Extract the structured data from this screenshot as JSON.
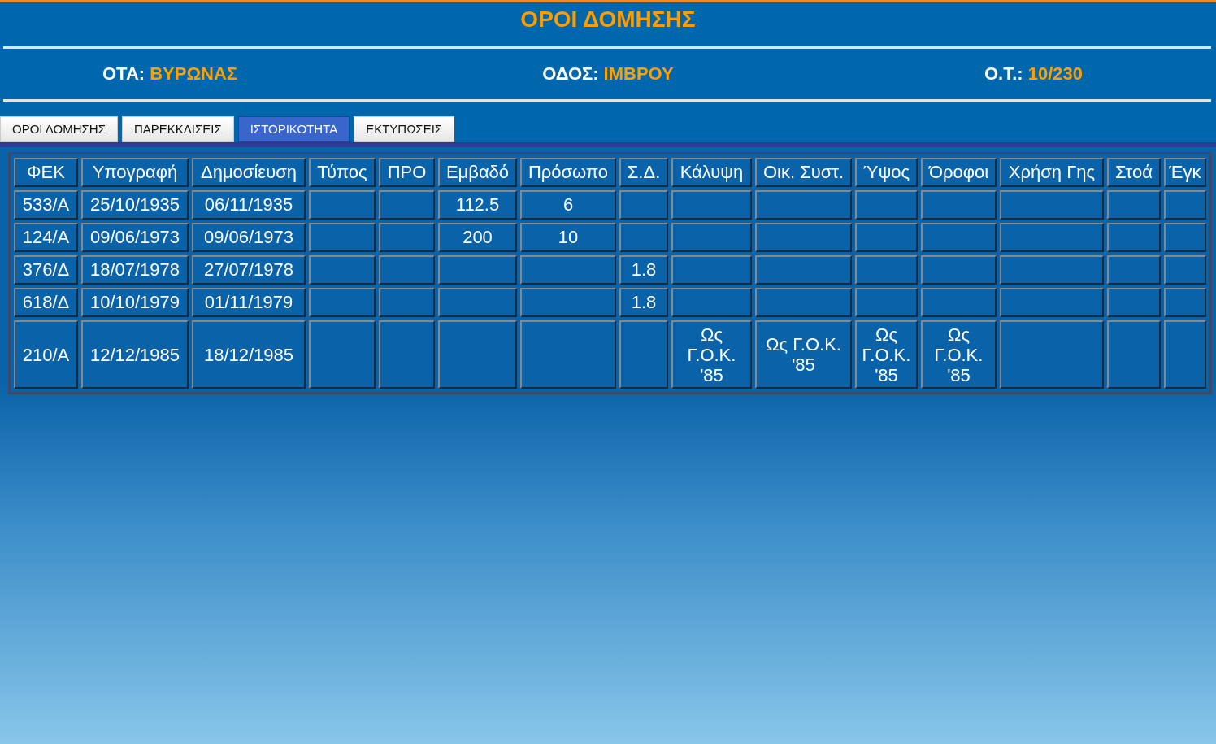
{
  "title": "ΟΡΟΙ ΔΟΜΗΣΗΣ",
  "info": [
    {
      "label": "ΟΤΑ:",
      "value": "ΒΥΡΩΝΑΣ"
    },
    {
      "label": "ΟΔΟΣ:",
      "value": "ΙΜΒΡΟΥ"
    },
    {
      "label": "Ο.Τ.:",
      "value": "10/230"
    }
  ],
  "tabs": [
    {
      "label": "ΟΡΟΙ ΔΟΜΗΣΗΣ",
      "selected": false
    },
    {
      "label": "ΠΑΡΕΚΚΛΙΣΕΙΣ",
      "selected": false
    },
    {
      "label": "ΙΣΤΟΡΙΚΟΤΗΤΑ",
      "selected": true
    },
    {
      "label": "ΕΚΤΥΠΩΣΕΙΣ",
      "selected": false
    }
  ],
  "table": {
    "columns": [
      "ΦΕΚ",
      "Υπογραφή",
      "Δημοσίευση",
      "Τύπος",
      "ΠΡΟ",
      "Εμβαδό",
      "Πρόσωπο",
      "Σ.Δ.",
      "Κάλυψη",
      "Οικ. Συστ.",
      "Ύψος",
      "Όροφοι",
      "Χρήση Γης",
      "Στοά",
      "Έγκ"
    ],
    "rows": [
      [
        "533/Α",
        "25/10/1935",
        "06/11/1935",
        null,
        null,
        "112.5",
        "6",
        null,
        null,
        null,
        null,
        null,
        null,
        null,
        null
      ],
      [
        "124/Α",
        "09/06/1973",
        "09/06/1973",
        null,
        null,
        "200",
        "10",
        null,
        null,
        null,
        null,
        null,
        null,
        null,
        null
      ],
      [
        "376/Δ",
        "18/07/1978",
        "27/07/1978",
        null,
        null,
        null,
        null,
        "1.8",
        null,
        null,
        null,
        null,
        null,
        null,
        null
      ],
      [
        "618/Δ",
        "10/10/1979",
        "01/11/1979",
        null,
        null,
        null,
        null,
        "1.8",
        null,
        null,
        null,
        null,
        null,
        null,
        null
      ],
      [
        "210/Α",
        "12/12/1985",
        "18/12/1985",
        null,
        null,
        null,
        null,
        null,
        "Ως Γ.Ο.Κ. '85",
        "Ως Γ.Ο.Κ. '85",
        "Ως Γ.Ο.Κ. '85",
        "Ως Γ.Ο.Κ. '85",
        null,
        null,
        null
      ]
    ]
  }
}
